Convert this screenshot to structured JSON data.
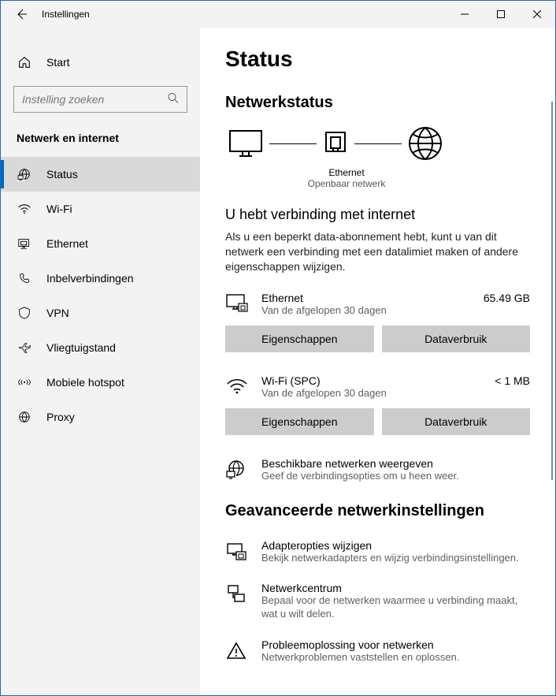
{
  "window": {
    "title": "Instellingen"
  },
  "sidebar": {
    "home": "Start",
    "search_placeholder": "Instelling zoeken",
    "section": "Netwerk en internet",
    "items": [
      {
        "label": "Status",
        "icon": "status-icon",
        "active": true
      },
      {
        "label": "Wi-Fi",
        "icon": "wifi-icon",
        "active": false
      },
      {
        "label": "Ethernet",
        "icon": "ethernet-icon",
        "active": false
      },
      {
        "label": "Inbelverbindingen",
        "icon": "dialup-icon",
        "active": false
      },
      {
        "label": "VPN",
        "icon": "vpn-icon",
        "active": false
      },
      {
        "label": "Vliegtuigstand",
        "icon": "airplane-icon",
        "active": false
      },
      {
        "label": "Mobiele hotspot",
        "icon": "hotspot-icon",
        "active": false
      },
      {
        "label": "Proxy",
        "icon": "globe-icon",
        "active": false
      }
    ]
  },
  "main": {
    "page_title": "Status",
    "netstatus_heading": "Netwerkstatus",
    "diagram": {
      "device": "Ethernet",
      "network_type": "Openbaar netwerk"
    },
    "connected_heading": "U hebt verbinding met internet",
    "connected_desc": "Als u een beperkt data-abonnement hebt, kunt u van dit netwerk een verbinding met een datalimiet maken of andere eigenschappen wijzigen.",
    "connections": [
      {
        "name": "Ethernet",
        "period": "Van de afgelopen 30 dagen",
        "usage": "65.49 GB",
        "props_btn": "Eigenschappen",
        "data_btn": "Dataverbruik",
        "icon": "ethernet-pc-icon"
      },
      {
        "name": "Wi-Fi (SPC)",
        "period": "Van de afgelopen 30 dagen",
        "usage": "< 1 MB",
        "props_btn": "Eigenschappen",
        "data_btn": "Dataverbruik",
        "icon": "wifi-icon"
      }
    ],
    "available": {
      "title": "Beschikbare netwerken weergeven",
      "desc": "Geef de verbindingsopties om u heen weer."
    },
    "advanced_heading": "Geavanceerde netwerkinstellingen",
    "advanced_items": [
      {
        "title": "Adapteropties wijzigen",
        "desc": "Bekijk netwerkadapters en wijzig verbindingsinstellingen.",
        "icon": "adapter-icon"
      },
      {
        "title": "Netwerkcentrum",
        "desc": "Bepaal voor de netwerken waarmee u verbinding maakt, wat u wilt delen.",
        "icon": "network-center-icon"
      },
      {
        "title": "Probleemoplossing voor netwerken",
        "desc": "Netwerkproblemen vaststellen en oplossen.",
        "icon": "warning-icon"
      }
    ]
  }
}
